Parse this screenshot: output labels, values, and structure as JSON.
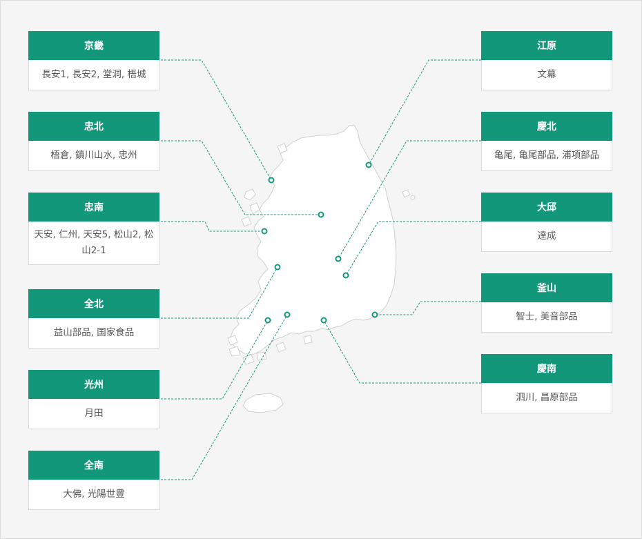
{
  "colors": {
    "accent": "#13977a",
    "map_fill": "#ffffff",
    "map_outline": "#d0d0d0",
    "background": "#f5f5f5",
    "leader_line": "#13977a"
  },
  "regions": {
    "gyeonggi": {
      "name": "京畿",
      "sites": "長安1, 長安2, 堂洞, 梧城"
    },
    "chungbuk": {
      "name": "忠北",
      "sites": "梧倉, 鎮川山水, 忠州"
    },
    "chungnam": {
      "name": "忠南",
      "sites": "天安, 仁州, 天安5, 松山2, 松山2-1"
    },
    "jeonbuk": {
      "name": "全北",
      "sites": "益山部品, 国家食品"
    },
    "gwangju": {
      "name": "光州",
      "sites": "月田"
    },
    "jeonnam": {
      "name": "全南",
      "sites": "大佛, 光陽世豊"
    },
    "gangwon": {
      "name": "江原",
      "sites": "文幕"
    },
    "gyeongbuk": {
      "name": "慶北",
      "sites": "亀尾, 亀尾部品, 浦項部品"
    },
    "daegu": {
      "name": "大邱",
      "sites": "達成"
    },
    "busan": {
      "name": "釜山",
      "sites": "智士, 美音部品"
    },
    "gyeongnam": {
      "name": "慶南",
      "sites": "泗川, 昌原部品"
    }
  }
}
